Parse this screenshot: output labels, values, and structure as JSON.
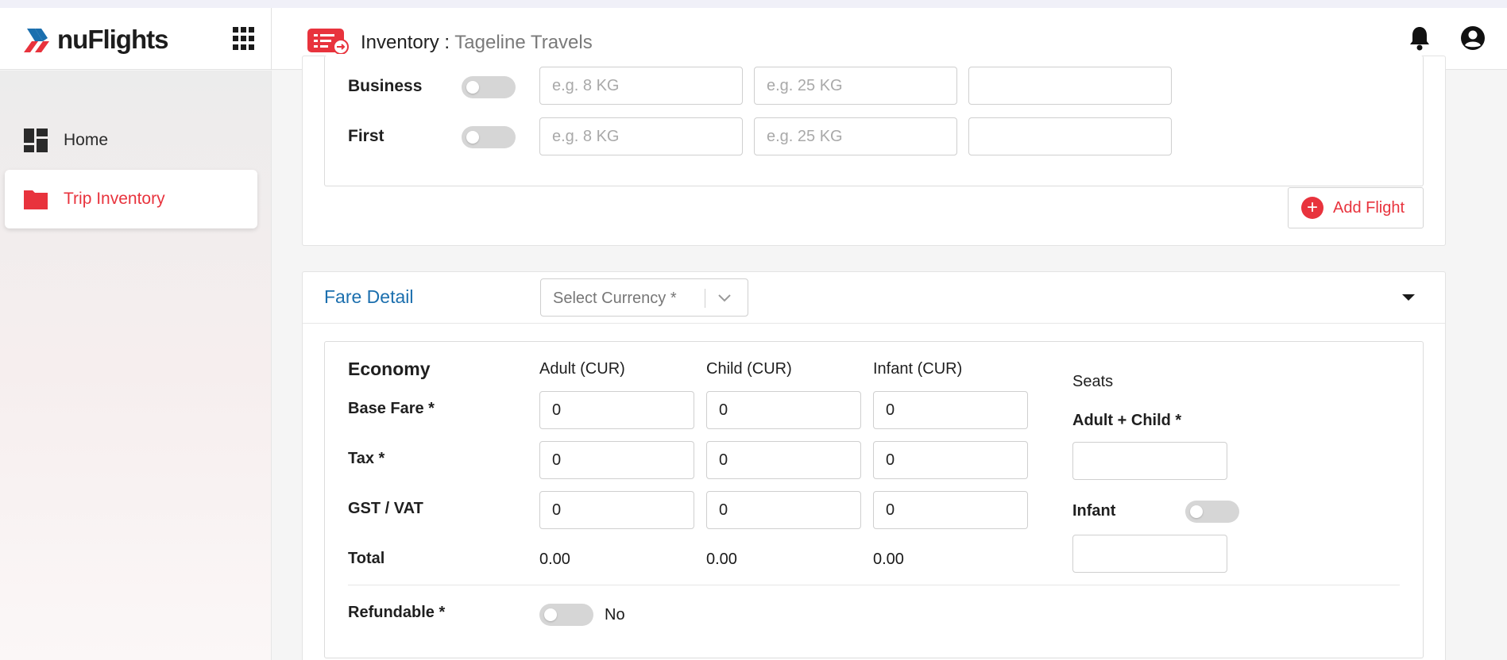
{
  "app": {
    "logo_text": "nuFlights"
  },
  "header": {
    "title": "Inventory :",
    "subtitle": "Tageline Travels",
    "icons": [
      "apps-grid-icon",
      "inventory-ticket-icon",
      "bell-icon",
      "account-circle-icon"
    ]
  },
  "sidebar": {
    "items": [
      {
        "label": "Home",
        "icon": "dashboard-icon"
      },
      {
        "label": "Trip Inventory",
        "icon": "folder-icon",
        "active": true
      }
    ]
  },
  "baggage": {
    "rows": [
      {
        "label": "Business",
        "cabin_placeholder": "e.g. 8 KG",
        "checkin_placeholder": "e.g. 25 KG",
        "extra_value": ""
      },
      {
        "label": "First",
        "cabin_placeholder": "e.g. 8 KG",
        "checkin_placeholder": "e.g. 25 KG",
        "extra_value": ""
      }
    ],
    "add_flight_label": "Add Flight"
  },
  "fare_detail": {
    "title": "Fare Detail",
    "currency_placeholder": "Select Currency *",
    "class_name": "Economy",
    "columns": [
      "Adult (CUR)",
      "Child (CUR)",
      "Infant (CUR)"
    ],
    "rows": [
      {
        "label": "Base Fare *",
        "values": [
          "0",
          "0",
          "0"
        ]
      },
      {
        "label": "Tax *",
        "values": [
          "0",
          "0",
          "0"
        ]
      },
      {
        "label": "GST / VAT",
        "values": [
          "0",
          "0",
          "0"
        ]
      }
    ],
    "total": {
      "label": "Total",
      "values": [
        "0.00",
        "0.00",
        "0.00"
      ]
    },
    "seats": {
      "title": "Seats",
      "adult_child_label": "Adult + Child *",
      "adult_child_value": "",
      "infant_label": "Infant",
      "infant_value": ""
    },
    "refundable": {
      "label": "Refundable *",
      "value": "No"
    }
  },
  "colors": {
    "brand_red": "#e8333d",
    "accent_blue": "#1b6fae"
  }
}
